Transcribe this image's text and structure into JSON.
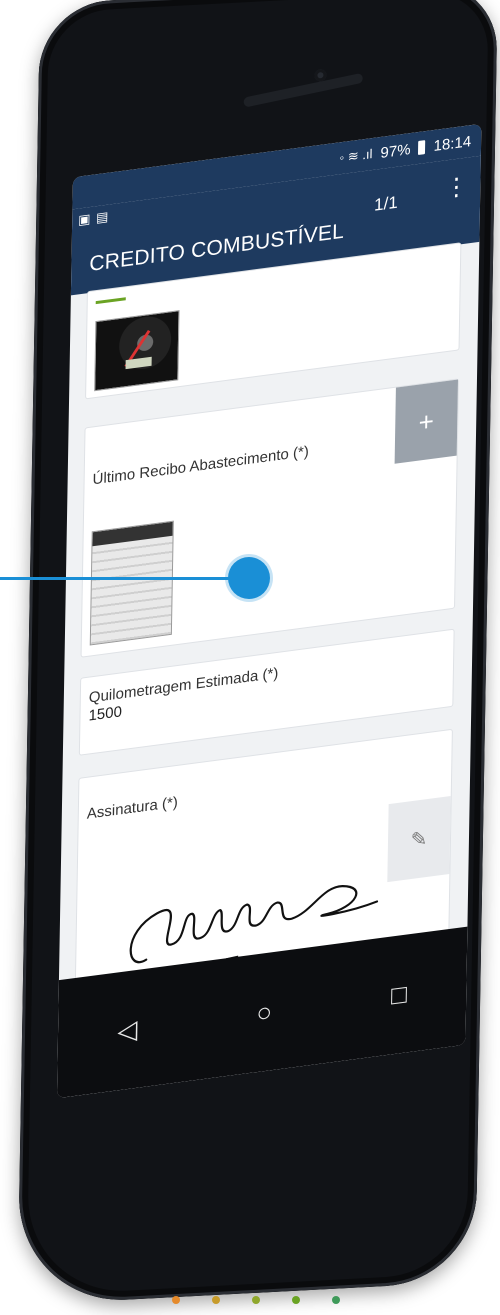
{
  "status_bar": {
    "signal_text": "◦ ≋ .ıl",
    "battery": "97%",
    "time": "18:14"
  },
  "app_bar": {
    "left_icons": "▣ ▤",
    "title": "CREDITO COMBUSTÍVEL",
    "page": "1/1",
    "menu_icon": "⋮"
  },
  "fields": {
    "receipt_label": "Último Recibo Abastecimento (*)",
    "add_button": "+",
    "km_label": "Quilometragem Estimada (*)",
    "km_value": "1500",
    "signature_label": "Assinatura (*)",
    "pen_icon": "✎"
  },
  "nav": {
    "back": "◁",
    "home": "○",
    "recents": "□"
  },
  "colors": {
    "header": "#1e3a5f",
    "accent": "#6aa323",
    "callout": "#1a8fd6"
  }
}
